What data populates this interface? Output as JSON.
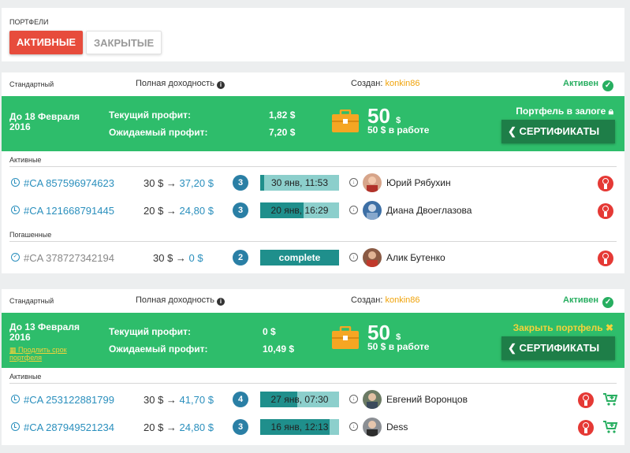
{
  "portfolios_label": "ПОРТФЕЛИ",
  "tabs": {
    "active": "АКТИВНЫЕ",
    "closed": "ЗАКРЫТЫЕ"
  },
  "cards": [
    {
      "type": "Стандартный",
      "yield_label": "Полная доходность",
      "created_label": "Создан:",
      "owner": "konkin86",
      "status": "Активен",
      "until": "До 18 Февраля 2016",
      "current_profit_label": "Текущий профит:",
      "current_profit": "1,82 $",
      "expected_profit_label": "Ожидаемый профит:",
      "expected_profit": "7,20 $",
      "amount": "50",
      "amount_currency": "$",
      "in_work": "50 $ в работе",
      "pledge": "Портфель в залоге",
      "cert_button": "СЕРТИФИКАТЫ",
      "active_label": "Активные",
      "redeemed_label": "Погашенные",
      "active_rows": [
        {
          "ca": "#CA 857596974623",
          "from": "30 $",
          "to": "37,20 $",
          "count": "3",
          "time": "30 янв, 11:53",
          "progress": 0.05,
          "name": "Юрий Рябухин"
        },
        {
          "ca": "#CA 121668791445",
          "from": "20 $",
          "to": "24,80 $",
          "count": "3",
          "time": "20 янв, 16:29",
          "progress": 0.55,
          "name": "Диана Двоеглазова"
        }
      ],
      "redeemed_rows": [
        {
          "ca": "#CA 378727342194",
          "from": "30 $",
          "to": "0 $",
          "count": "2",
          "time": "complete",
          "name": "Алик Бутенко"
        }
      ]
    },
    {
      "type": "Стандартный",
      "yield_label": "Полная доходность",
      "created_label": "Создан:",
      "owner": "konkin86",
      "status": "Активен",
      "until": "До 13 Февраля 2016",
      "extend": "Продлить срок портфеля",
      "current_profit_label": "Текущий профит:",
      "current_profit": "0 $",
      "expected_profit_label": "Ожидаемый профит:",
      "expected_profit": "10,49 $",
      "amount": "50",
      "amount_currency": "$",
      "in_work": "50 $ в работе",
      "close": "Закрыть портфель",
      "cert_button": "СЕРТИФИКАТЫ",
      "active_label": "Активные",
      "active_rows": [
        {
          "ca": "#CA 253122881799",
          "from": "30 $",
          "to": "41,70 $",
          "count": "4",
          "time": "27 янв, 07:30",
          "progress": 0.47,
          "name": "Евгений Воронцов"
        },
        {
          "ca": "#CA 287949521234",
          "from": "20 $",
          "to": "24,80 $",
          "count": "3",
          "time": "16 янв, 12:13",
          "progress": 0.88,
          "name": "Dess"
        }
      ]
    }
  ],
  "colors": {
    "green": "#2ebd6b",
    "red": "#e74c3c",
    "link": "#2a8fbd",
    "owner": "#f0a30a"
  }
}
